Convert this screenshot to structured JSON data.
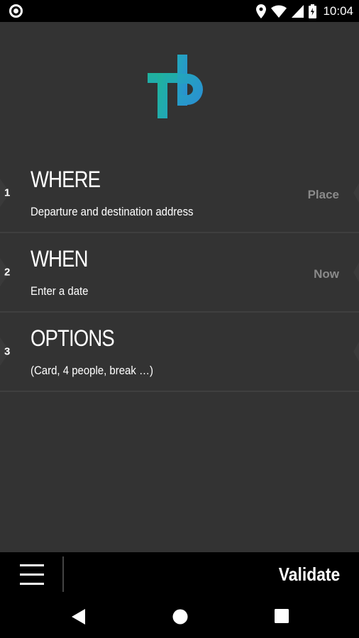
{
  "status_bar": {
    "time": "10:04",
    "icons": [
      "notification-circle-icon",
      "location-icon",
      "wifi-icon",
      "signal-icon",
      "battery-icon"
    ]
  },
  "logo": {
    "name": "tb-logo",
    "colors": {
      "teal": "#1fb39a",
      "blue": "#2a8fd4"
    }
  },
  "steps": [
    {
      "number": "1",
      "title": "WHERE",
      "subtitle": "Departure and destination address",
      "value": "Place"
    },
    {
      "number": "2",
      "title": "WHEN",
      "subtitle": "Enter a date",
      "value": "Now"
    },
    {
      "number": "3",
      "title": "OPTIONS",
      "subtitle": "(Card, 4 people, break …)",
      "value": ""
    }
  ],
  "bottom_bar": {
    "menu_icon": "hamburger-menu-icon",
    "validate_label": "Validate"
  },
  "nav_bar": {
    "icons": [
      "back-icon",
      "home-icon",
      "recents-icon"
    ]
  },
  "colors": {
    "background": "#333333",
    "bar": "#000000",
    "text": "#ffffff",
    "muted_value": "#8a8a8a",
    "separator": "#3f3f3f"
  }
}
